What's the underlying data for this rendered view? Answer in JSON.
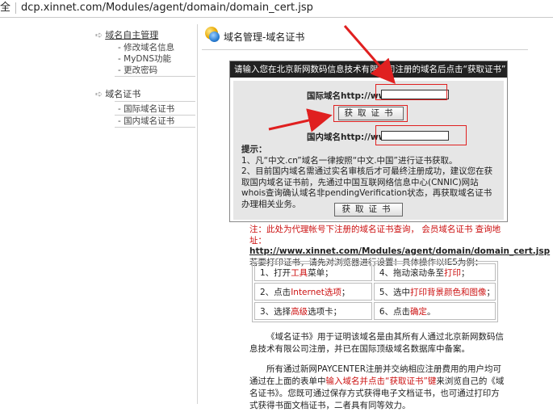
{
  "address_bar": {
    "prefix": "全",
    "url": "dcp.xinnet.com/Modules/agent/domain/domain_cert.jsp"
  },
  "sidebar": {
    "sections": [
      {
        "title": "域名自主管理",
        "items": [
          "修改域名信息",
          "MyDNS功能",
          "更改密码"
        ]
      },
      {
        "title": "域名证书",
        "items": [
          "国际域名证书",
          "国内域名证书"
        ]
      }
    ]
  },
  "page_title": "域名管理-域名证书",
  "panel": {
    "instruction": "请输入您在北京新网数码信息技术有限公司注册的域名后点击“获取证书”",
    "intl_label": "国际域名http://www.",
    "intl_value": "",
    "get_cert_button": "获取证书",
    "cn_label": "国内域名http://www.",
    "cn_value": "",
    "tips_title": "提示：",
    "tip1": "1、凡“中文.cn”域名一律按照“中文.中国”进行证书获取。",
    "tip2": "2、目前国内域名需通过实名审核后才可最终注册成功，建议您在获取国内域名证书前，先通过中国互联网络信息中心(CNNIC)网站whois查询确认域名非pendingVerification状态，再获取域名证书办理相关业务。",
    "get_cert_button2": "获取证书"
  },
  "notice": {
    "line1": "注：此处为代理帐号下注册的域名证书查询， 会员域名证书 查询地址：",
    "url": "http://www.xinnet.com/Modules/agent/domain/domain_cert.jsp",
    "line2": "若要打印证书，请先对浏览器进行设置！具体操作以IE5为例："
  },
  "print_steps": [
    {
      "pre": "1、打开",
      "red": "工具",
      "post": "菜单；"
    },
    {
      "pre": "4、拖动滚动条至",
      "red": "打印",
      "post": "；"
    },
    {
      "pre": "2、点击",
      "red": "Internet选项",
      "post": "；"
    },
    {
      "pre": "5、选中",
      "red": "打印背景颜色和图像",
      "post": "；"
    },
    {
      "pre": "3、选择",
      "red": "高级",
      "post": "选项卡；"
    },
    {
      "pre": "6、点击",
      "red": "确定",
      "post": "。"
    }
  ],
  "para1": "《域名证书》用于证明该域名是由其所有人通过北京新网数码信息技术有限公司注册，并已在国际顶级域名数据库中备案。",
  "para2": {
    "a": "所有通过新网PAYCENTER注册并交纳相应注册费用的用户均可通过在上面的表单中",
    "red": "输入域名并点击“获取证书”键",
    "b": "来浏览自己的《域名证书》。您既可通过保存方式获得电子文档证书，也可通过打印方式获得书面文档证书，二者具有同等效力。"
  },
  "colors": {
    "annotation_red": "#e02020",
    "bar_black": "#222222",
    "panel_gray": "#e6e6e6"
  }
}
